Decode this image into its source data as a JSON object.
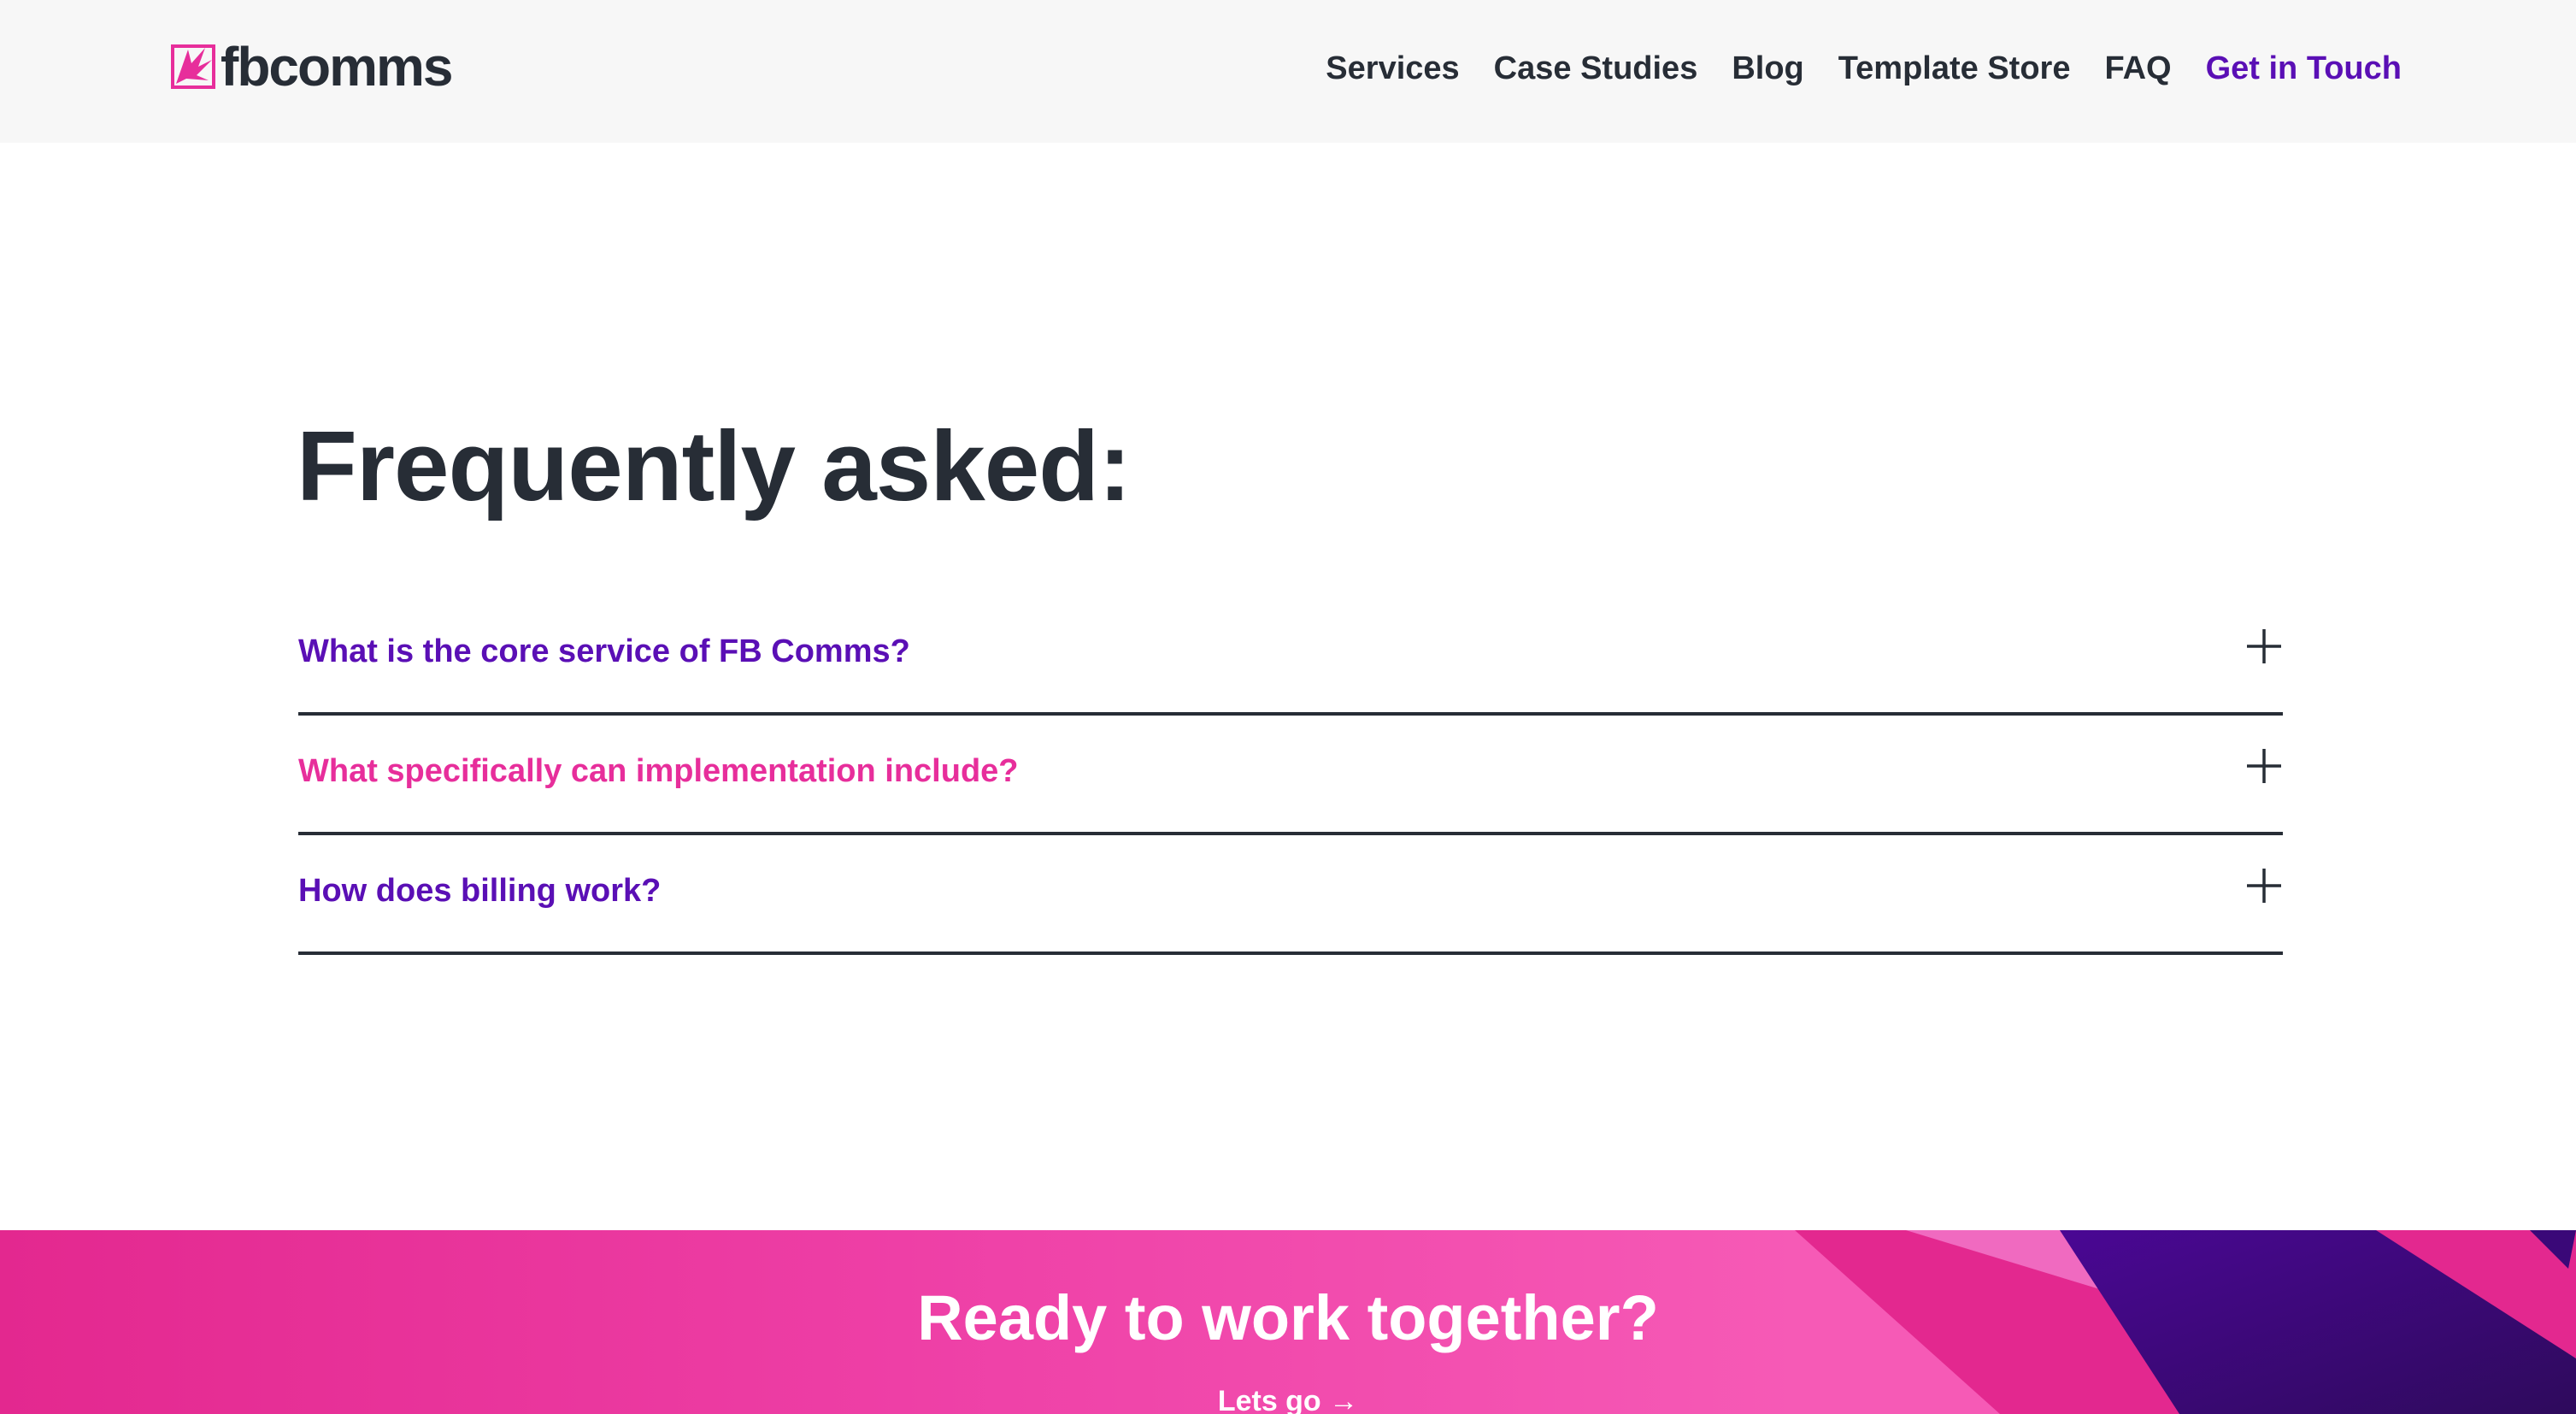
{
  "brand": {
    "name": "fbcomms",
    "accent_purple": "#5a0fb5",
    "accent_pink": "#e72e9b",
    "text_dark": "#272d36"
  },
  "nav": {
    "items": [
      {
        "label": "Services"
      },
      {
        "label": "Case Studies"
      },
      {
        "label": "Blog"
      },
      {
        "label": "Template Store"
      },
      {
        "label": "FAQ"
      }
    ],
    "cta_label": "Get in Touch"
  },
  "faq": {
    "title": "Frequently asked:",
    "items": [
      {
        "question": "What is the core service of FB Comms?",
        "icon": "plus-icon"
      },
      {
        "question": "What specifically can implementation include?",
        "icon": "plus-icon"
      },
      {
        "question": "How does billing work?",
        "icon": "plus-icon"
      }
    ]
  },
  "cta_banner": {
    "title": "Ready to work together?",
    "link_label": "Lets go",
    "link_icon": "arrow-right-icon"
  }
}
